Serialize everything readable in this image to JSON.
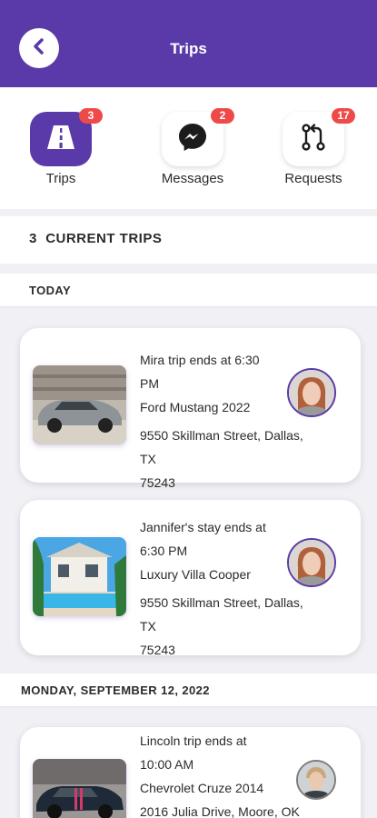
{
  "header": {
    "title": "Trips"
  },
  "tabs": [
    {
      "label": "Trips",
      "badge": "3",
      "icon": "road-icon",
      "active": true
    },
    {
      "label": "Messages",
      "badge": "2",
      "icon": "messenger-icon",
      "active": false
    },
    {
      "label": "Requests",
      "badge": "17",
      "icon": "pull-request-icon",
      "active": false
    }
  ],
  "summary": {
    "count": "3",
    "label": "CURRENT TRIPS"
  },
  "groups": [
    {
      "date": "TODAY",
      "trips": [
        {
          "line1": "Mira trip ends at 6:30",
          "line2": "PM",
          "vehicle": "Ford Mustang 2022",
          "address1": "9550 Skillman Street, Dallas, TX",
          "address2": "75243"
        },
        {
          "line1": "Jannifer's stay ends at",
          "line2": "6:30 PM",
          "vehicle": "Luxury Villa Cooper",
          "address1": "9550 Skillman Street, Dallas, TX",
          "address2": "75243"
        }
      ]
    },
    {
      "date": "MONDAY, SEPTEMBER 12, 2022",
      "trips": [
        {
          "line1": "Lincoln trip ends at",
          "line2": "10:00 AM",
          "vehicle": "Chevrolet Cruze 2014",
          "address1": "2016 Julia Drive, Moore, OK",
          "address2": ""
        }
      ]
    }
  ],
  "colors": {
    "primary": "#5a3aa8",
    "badge": "#ef4a4a",
    "background": "#f1f0f5"
  }
}
